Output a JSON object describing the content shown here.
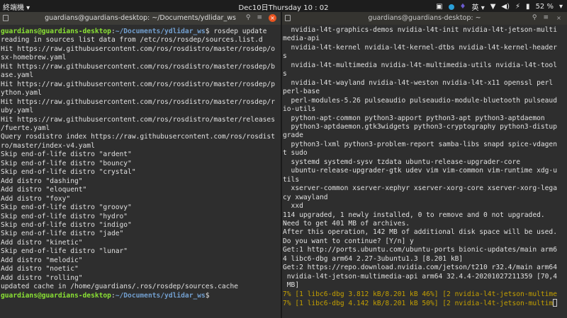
{
  "topbar": {
    "app_menu": "終端機 ▾",
    "clock": "Dec10日Thursday 10 : 02",
    "input_method": "英 ▾",
    "battery": "52 %",
    "accent": "#e95420"
  },
  "left_terminal": {
    "title": "guardians@guardians-desktop: ~/Documents/ydlidar_ws",
    "lines": [
      {
        "user": "guardians@guardians-desktop",
        "sep": ":",
        "path": "~/Documents/ydlidar_ws",
        "cmd": "$ rosdep update"
      },
      {
        "text": "reading in sources list data from /etc/ros/rosdep/sources.list.d"
      },
      {
        "text": "Hit https://raw.githubusercontent.com/ros/rosdistro/master/rosdep/o"
      },
      {
        "text": "sx-homebrew.yaml"
      },
      {
        "text": "Hit https://raw.githubusercontent.com/ros/rosdistro/master/rosdep/b"
      },
      {
        "text": "ase.yaml"
      },
      {
        "text": "Hit https://raw.githubusercontent.com/ros/rosdistro/master/rosdep/p"
      },
      {
        "text": "ython.yaml"
      },
      {
        "text": "Hit https://raw.githubusercontent.com/ros/rosdistro/master/rosdep/r"
      },
      {
        "text": "uby.yaml"
      },
      {
        "text": "Hit https://raw.githubusercontent.com/ros/rosdistro/master/releases"
      },
      {
        "text": "/fuerte.yaml"
      },
      {
        "text": "Query rosdistro index https://raw.githubusercontent.com/ros/rosdist"
      },
      {
        "text": "ro/master/index-v4.yaml"
      },
      {
        "text": "Skip end-of-life distro \"ardent\""
      },
      {
        "text": "Skip end-of-life distro \"bouncy\""
      },
      {
        "text": "Skip end-of-life distro \"crystal\""
      },
      {
        "text": "Add distro \"dashing\""
      },
      {
        "text": "Add distro \"eloquent\""
      },
      {
        "text": "Add distro \"foxy\""
      },
      {
        "text": "Skip end-of-life distro \"groovy\""
      },
      {
        "text": "Skip end-of-life distro \"hydro\""
      },
      {
        "text": "Skip end-of-life distro \"indigo\""
      },
      {
        "text": "Skip end-of-life distro \"jade\""
      },
      {
        "text": "Add distro \"kinetic\""
      },
      {
        "text": "Skip end-of-life distro \"lunar\""
      },
      {
        "text": "Add distro \"melodic\""
      },
      {
        "text": "Add distro \"noetic\""
      },
      {
        "text": "Add distro \"rolling\""
      },
      {
        "text": "updated cache in /home/guardians/.ros/rosdep/sources.cache"
      },
      {
        "user": "guardians@guardians-desktop",
        "sep": ":",
        "path": "~/Documents/ydlidar_ws",
        "cmd": "$ "
      }
    ]
  },
  "right_terminal": {
    "title": "guardians@guardians-desktop: ~",
    "lines": [
      {
        "text": "  nvidia-l4t-graphics-demos nvidia-l4t-init nvidia-l4t-jetson-multi"
      },
      {
        "text": "media-api"
      },
      {
        "text": "  nvidia-l4t-kernel nvidia-l4t-kernel-dtbs nvidia-l4t-kernel-header"
      },
      {
        "text": "s"
      },
      {
        "text": "  nvidia-l4t-multimedia nvidia-l4t-multimedia-utils nvidia-l4t-tool"
      },
      {
        "text": "s"
      },
      {
        "text": "  nvidia-l4t-wayland nvidia-l4t-weston nvidia-l4t-x11 openssl perl"
      },
      {
        "text": "perl-base"
      },
      {
        "text": "  perl-modules-5.26 pulseaudio pulseaudio-module-bluetooth pulseaud"
      },
      {
        "text": "io-utils"
      },
      {
        "text": "  python-apt-common python3-apport python3-apt python3-aptdaemon"
      },
      {
        "text": "  python3-aptdaemon.gtk3widgets python3-cryptography python3-distup"
      },
      {
        "text": "grade"
      },
      {
        "text": "  python3-lxml python3-problem-report samba-libs snapd spice-vdagen"
      },
      {
        "text": "t sudo"
      },
      {
        "text": "  systemd systemd-sysv tzdata ubuntu-release-upgrader-core"
      },
      {
        "text": "  ubuntu-release-upgrader-gtk udev vim vim-common vim-runtime xdg-u"
      },
      {
        "text": "tils"
      },
      {
        "text": "  xserver-common xserver-xephyr xserver-xorg-core xserver-xorg-lega"
      },
      {
        "text": "cy xwayland"
      },
      {
        "text": "  xxd"
      },
      {
        "text": "114 upgraded, 1 newly installed, 0 to remove and 0 not upgraded."
      },
      {
        "text": "Need to get 401 MB of archives."
      },
      {
        "text": "After this operation, 142 MB of additional disk space will be used."
      },
      {
        "text": "Do you want to continue? [Y/n] y"
      },
      {
        "text": "Get:1 http://ports.ubuntu.com/ubuntu-ports bionic-updates/main arm6"
      },
      {
        "text": "4 libc6-dbg arm64 2.27-3ubuntu1.3 [8.201 kB]"
      },
      {
        "text": "Get:2 https://repo.download.nvidia.com/jetson/t210 r32.4/main arm64"
      },
      {
        "text": " nvidia-l4t-jetson-multimedia-api arm64 32.4.4-20201027211359 [70,4"
      },
      {
        "text": " MB]"
      },
      {
        "text": "7% [1 libc6-dbg 3.812 kB/8.201 kB 46%] [2 nvidia-l4t-jetson-multime",
        "progress": true
      },
      {
        "text": "7% [1 libc6-dbg 4.142 kB/8.201 kB 50%] [2 nvidia-l4t-jetson-multim",
        "progress": true,
        "cursor": true
      }
    ]
  }
}
